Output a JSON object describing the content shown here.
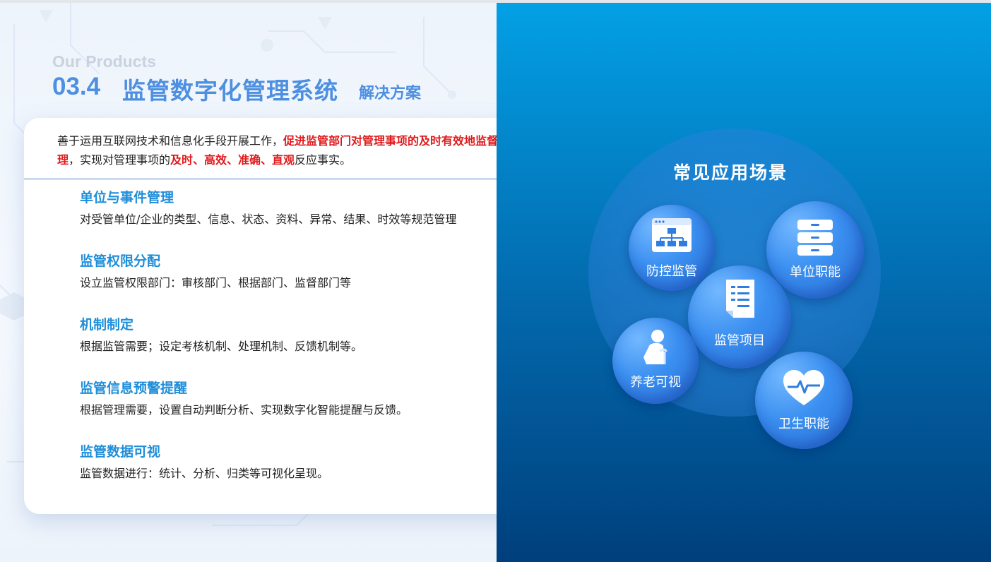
{
  "header": {
    "eyebrow": "Our Products",
    "number": "03.4",
    "title": "监管数字化管理系统",
    "subtitle": "解决方案"
  },
  "intro": {
    "part1": "善于运用互联网技术和信息化手段开展工作，",
    "part2_red": "促进监管部门对管理事项的及时有效地监督管理",
    "part3": "，实现对管理事项的",
    "part4_red": "及时、高效、准确、直观",
    "part5": "反应事实。"
  },
  "items": [
    {
      "title": "单位与事件管理",
      "desc": "对受管单位/企业的类型、信息、状态、资料、异常、结果、时效等规范管理"
    },
    {
      "title": "监管权限分配",
      "desc": "设立监管权限部门：审核部门、根据部门、监督部门等"
    },
    {
      "title": "机制制定",
      "desc": "根据监管需要；设定考核机制、处理机制、反馈机制等。"
    },
    {
      "title": "监管信息预警提醒",
      "desc": "根据管理需要，设置自动判断分析、实现数字化智能提醒与反馈。"
    },
    {
      "title": "监管数据可视",
      "desc": "监管数据进行：统计、分析、归类等可视化呈现。"
    }
  ],
  "scenes": {
    "title": "常见应用场景",
    "bubbles": [
      {
        "label": "防控监管",
        "icon": "org-chart-icon"
      },
      {
        "label": "单位职能",
        "icon": "cabinet-icon"
      },
      {
        "label": "监管项目",
        "icon": "document-icon"
      },
      {
        "label": "养老可视",
        "icon": "elderly-icon"
      },
      {
        "label": "卫生职能",
        "icon": "heart-pulse-icon"
      }
    ]
  },
  "colors": {
    "accent": "#4d8fe0",
    "item_title": "#1f8ed9",
    "highlight_red": "#e0191b",
    "panel_top": "#03a0e5",
    "panel_bottom": "#003f7c"
  }
}
